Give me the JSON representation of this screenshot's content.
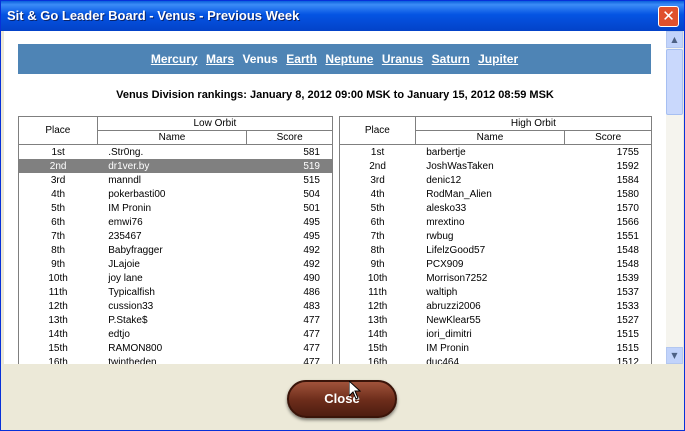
{
  "window": {
    "title": "Sit & Go Leader Board - Venus - Previous Week",
    "close_glyph": "✕"
  },
  "nav": {
    "planets": [
      "Mercury",
      "Mars",
      "Venus",
      "Earth",
      "Neptune",
      "Uranus",
      "Saturn",
      "Jupiter"
    ],
    "current": "Venus"
  },
  "heading": "Venus Division rankings: January 8, 2012 09:00 MSK to January 15, 2012 08:59 MSK",
  "low_orbit": {
    "group_label": "Low Orbit",
    "col_place": "Place",
    "col_name": "Name",
    "col_score": "Score",
    "selected_index": 1,
    "rows": [
      [
        "1st",
        ".Str0ng.",
        "581"
      ],
      [
        "2nd",
        "dr1ver.by",
        "519"
      ],
      [
        "3rd",
        "manndl",
        "515"
      ],
      [
        "4th",
        "pokerbasti00",
        "504"
      ],
      [
        "5th",
        "IM Pronin",
        "501"
      ],
      [
        "6th",
        "emwi76",
        "495"
      ],
      [
        "7th",
        "235467",
        "495"
      ],
      [
        "8th",
        "Babyfragger",
        "492"
      ],
      [
        "9th",
        "JLajoie",
        "492"
      ],
      [
        "10th",
        "joy lane",
        "490"
      ],
      [
        "11th",
        "Typicalfish",
        "486"
      ],
      [
        "12th",
        "cussion33",
        "483"
      ],
      [
        "13th",
        "P.Stake$",
        "477"
      ],
      [
        "14th",
        "edtjo",
        "477"
      ],
      [
        "15th",
        "RAMON800",
        "477"
      ],
      [
        "16th",
        "twintheden",
        "477"
      ]
    ]
  },
  "high_orbit": {
    "group_label": "High Orbit",
    "col_place": "Place",
    "col_name": "Name",
    "col_score": "Score",
    "rows": [
      [
        "1st",
        "barbertje",
        "1755"
      ],
      [
        "2nd",
        "JoshWasTaken",
        "1592"
      ],
      [
        "3rd",
        "denic12",
        "1584"
      ],
      [
        "4th",
        "RodMan_Alien",
        "1580"
      ],
      [
        "5th",
        "alesko33",
        "1570"
      ],
      [
        "6th",
        "mrextino",
        "1566"
      ],
      [
        "7th",
        "rwbug",
        "1551"
      ],
      [
        "8th",
        "LifelzGood57",
        "1548"
      ],
      [
        "9th",
        "PCX909",
        "1548"
      ],
      [
        "10th",
        "Morrison7252",
        "1539"
      ],
      [
        "11th",
        "waltiph",
        "1537"
      ],
      [
        "12th",
        "abruzzi2006",
        "1533"
      ],
      [
        "13th",
        "NewKlear55",
        "1527"
      ],
      [
        "14th",
        "iori_dimitri",
        "1515"
      ],
      [
        "15th",
        "IM Pronin",
        "1515"
      ],
      [
        "16th",
        "duc464",
        "1512"
      ]
    ]
  },
  "footer": {
    "close_label": "Close"
  },
  "scrollbar": {
    "up_glyph": "▲",
    "down_glyph": "▼"
  }
}
